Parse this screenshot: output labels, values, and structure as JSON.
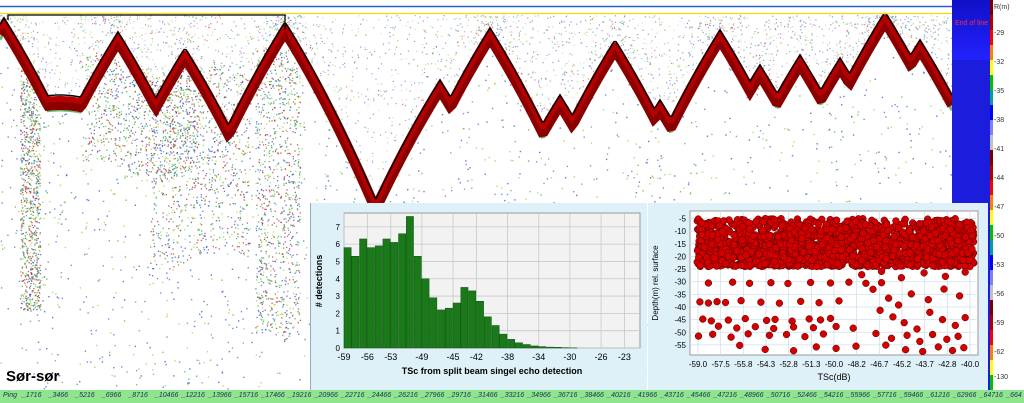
{
  "transect": {
    "label": "Sør-sør"
  },
  "sidebar": {
    "end_of_line": "End of line"
  },
  "depth_scale": {
    "unit": "R(m)",
    "ticks": [
      "-29",
      "-32",
      "-35",
      "-38",
      "-41",
      "-44",
      "-47",
      "-50",
      "-53",
      "-56",
      "-59",
      "-62",
      "-130"
    ],
    "colors": [
      "#7a0000",
      "#b00000",
      "#ff0000",
      "#ff7f00",
      "#ffff00",
      "#00c000",
      "#00a0a0",
      "#0000ff",
      "#8080ff",
      "#c0c0c0"
    ]
  },
  "ping_axis": {
    "prefix": "Ping",
    "labels": [
      "1716",
      "3466",
      "5216",
      "6966",
      "8716",
      "10466",
      "12216",
      "13966",
      "15716",
      "17466",
      "19216",
      "20966",
      "22716",
      "24466",
      "26216",
      "27966",
      "29716",
      "31466",
      "33216",
      "34966",
      "36716",
      "38466",
      "40216",
      "41966",
      "43716",
      "45466",
      "47216",
      "48966",
      "50716",
      "52466",
      "54216",
      "55966",
      "57716",
      "59466",
      "61216",
      "62966",
      "64716",
      "664"
    ]
  },
  "histogram": {
    "ylabel": "# detections",
    "xlabel": "TSc from split beam singel echo detection",
    "yticks": [
      "0",
      "1",
      "2",
      "3",
      "4",
      "5",
      "6",
      "7"
    ],
    "xticks": [
      "-59",
      "-56",
      "-53",
      "-49",
      "-45",
      "-42",
      "-38",
      "-34",
      "-30",
      "-26",
      "-23"
    ]
  },
  "scatter": {
    "ylabel": "Depth(m) rel. surface",
    "xlabel": "TSc(dB)",
    "yticks": [
      "-5",
      "-10",
      "-15",
      "-20",
      "-25",
      "-30",
      "-35",
      "-40",
      "-45",
      "-50",
      "-55"
    ],
    "xticks": [
      "-59.0",
      "-57.5",
      "-55.8",
      "-54.3",
      "-52.8",
      "-51.3",
      "-50.0",
      "-48.2",
      "-46.7",
      "-45.2",
      "-43.7",
      "-42.8",
      "-40.0"
    ]
  },
  "chart_data": [
    {
      "type": "bar",
      "xlabel": "TSc from split beam singel echo detection",
      "ylabel": "# detections",
      "ylim": [
        0,
        7.8
      ],
      "xlim": [
        -59,
        -21
      ],
      "grid": true,
      "bar_color": "#1a7a1a",
      "bin_width": 1,
      "bin_starts": [
        -59,
        -58,
        -57,
        -56,
        -55,
        -54,
        -53,
        -52,
        -51,
        -50,
        -49,
        -48,
        -47,
        -46,
        -45,
        -44,
        -43,
        -42,
        -41,
        -40,
        -39,
        -38,
        -37,
        -36,
        -35,
        -34,
        -33,
        -32,
        -31,
        -30
      ],
      "values": [
        5.8,
        5.3,
        6.3,
        5.8,
        5.9,
        6.3,
        6.1,
        6.6,
        7.6,
        5.3,
        4.0,
        2.9,
        2.2,
        2.3,
        2.6,
        3.5,
        3.3,
        2.7,
        1.8,
        1.3,
        0.8,
        0.5,
        0.3,
        0.2,
        0.12,
        0.08,
        0.05,
        0.04,
        0.02,
        0.01
      ]
    },
    {
      "type": "scatter",
      "xlabel": "TSc(dB)",
      "ylabel": "Depth(m) rel. surface",
      "xlim": [
        -59.5,
        -39.2
      ],
      "ylim": [
        -59,
        -2
      ],
      "grid": true,
      "marker_color": "#d40000",
      "dense_region": {
        "x": [
          -59.0,
          -39.5
        ],
        "y": [
          -5,
          -24
        ],
        "count": 1800
      },
      "points": [
        [
          -58.2,
          -30.5
        ],
        [
          -56.5,
          -30.2
        ],
        [
          -55.3,
          -30.6
        ],
        [
          -53.8,
          -30.4
        ],
        [
          -52.6,
          -30.7
        ],
        [
          -51.0,
          -30.3
        ],
        [
          -49.6,
          -30.5
        ],
        [
          -48.3,
          -30.2
        ],
        [
          -47.1,
          -30.6
        ],
        [
          -46.0,
          -30.4
        ],
        [
          -58.8,
          -38.0
        ],
        [
          -58.2,
          -38.4
        ],
        [
          -57.6,
          -37.9
        ],
        [
          -57.0,
          -38.2
        ],
        [
          -55.9,
          -37.5
        ],
        [
          -54.5,
          -38.1
        ],
        [
          -53.2,
          -38.5
        ],
        [
          -51.7,
          -37.8
        ],
        [
          -50.4,
          -38.3
        ],
        [
          -49.0,
          -37.6
        ],
        [
          -58.6,
          -44.8
        ],
        [
          -58.0,
          -45.5
        ],
        [
          -56.8,
          -45.2
        ],
        [
          -55.6,
          -44.6
        ],
        [
          -54.1,
          -45.3
        ],
        [
          -53.5,
          -44.9
        ],
        [
          -52.3,
          -45.6
        ],
        [
          -51.1,
          -44.7
        ],
        [
          -50.3,
          -45.1
        ],
        [
          -49.6,
          -44.5
        ],
        [
          -57.5,
          -47.6
        ],
        [
          -56.2,
          -48.3
        ],
        [
          -54.9,
          -47.8
        ],
        [
          -53.6,
          -48.5
        ],
        [
          -52.2,
          -47.9
        ],
        [
          -50.8,
          -48.2
        ],
        [
          -49.2,
          -47.7
        ],
        [
          -48.0,
          -48.4
        ],
        [
          -58.9,
          -51.5
        ],
        [
          -57.9,
          -50.8
        ],
        [
          -56.6,
          -51.9
        ],
        [
          -55.4,
          -50.6
        ],
        [
          -53.9,
          -51.2
        ],
        [
          -52.7,
          -50.9
        ],
        [
          -51.4,
          -51.7
        ],
        [
          -50.1,
          -50.7
        ],
        [
          -56.0,
          -55.2
        ],
        [
          -54.2,
          -56.8
        ],
        [
          -52.2,
          -57.3
        ],
        [
          -50.6,
          -55.8
        ],
        [
          -49.2,
          -56.4
        ],
        [
          -47.8,
          -55.5
        ],
        [
          -46.6,
          -33.0
        ],
        [
          -45.5,
          -36.5
        ],
        [
          -44.8,
          -39.2
        ],
        [
          -43.9,
          -34.8
        ],
        [
          -42.7,
          -37.1
        ],
        [
          -41.6,
          -32.9
        ],
        [
          -40.5,
          -35.6
        ],
        [
          -46.1,
          -41.3
        ],
        [
          -45.2,
          -43.9
        ],
        [
          -44.4,
          -46.2
        ],
        [
          -43.5,
          -48.7
        ],
        [
          -42.6,
          -42.1
        ],
        [
          -41.7,
          -45.0
        ],
        [
          -40.8,
          -47.3
        ],
        [
          -40.1,
          -44.2
        ],
        [
          -46.4,
          -50.5
        ],
        [
          -45.3,
          -52.4
        ],
        [
          -44.2,
          -51.2
        ],
        [
          -43.3,
          -53.6
        ],
        [
          -42.4,
          -50.9
        ],
        [
          -41.4,
          -52.8
        ],
        [
          -40.6,
          -51.6
        ],
        [
          -45.7,
          -55.1
        ],
        [
          -44.3,
          -56.9
        ],
        [
          -43.1,
          -57.6
        ],
        [
          -42.0,
          -55.8
        ],
        [
          -41.0,
          -57.2
        ],
        [
          -40.2,
          -56.1
        ],
        [
          -47.4,
          -27.2
        ],
        [
          -46.0,
          -25.9
        ],
        [
          -44.6,
          -28.4
        ],
        [
          -43.0,
          -26.5
        ],
        [
          -41.5,
          -27.9
        ],
        [
          -40.1,
          -26.2
        ]
      ]
    }
  ]
}
